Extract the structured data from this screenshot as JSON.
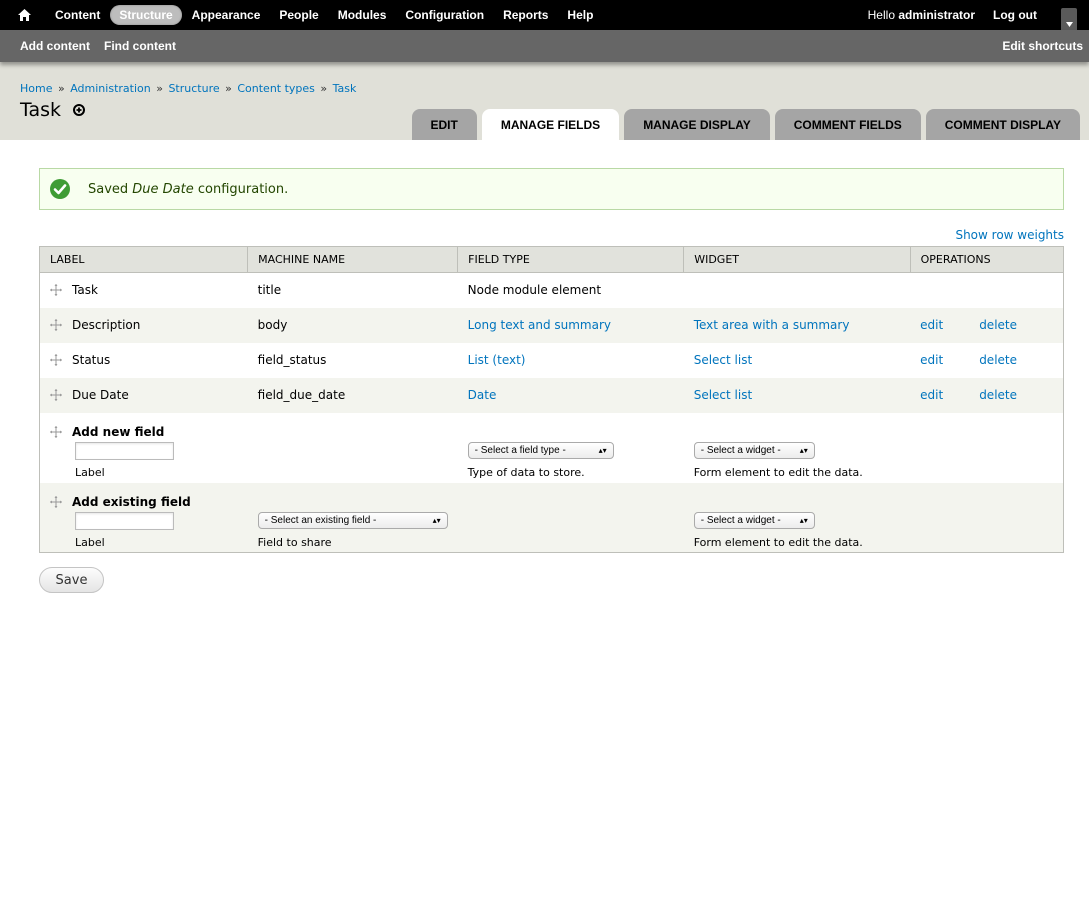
{
  "toolbar": {
    "menu": [
      "Content",
      "Structure",
      "Appearance",
      "People",
      "Modules",
      "Configuration",
      "Reports",
      "Help"
    ],
    "hello_prefix": "Hello ",
    "username": "administrator",
    "logout": "Log out"
  },
  "shortcuts": {
    "add_content": "Add content",
    "find_content": "Find content",
    "edit_shortcuts": "Edit shortcuts"
  },
  "breadcrumb": [
    "Home",
    "Administration",
    "Structure",
    "Content types",
    "Task"
  ],
  "breadcrumb_sep": "»",
  "page_title": "Task",
  "tabs": [
    "EDIT",
    "MANAGE FIELDS",
    "MANAGE DISPLAY",
    "COMMENT FIELDS",
    "COMMENT DISPLAY"
  ],
  "status": {
    "prefix": "Saved ",
    "field": "Due Date",
    "suffix": " configuration."
  },
  "show_row_weights": "Show row weights",
  "table": {
    "headers": [
      "LABEL",
      "MACHINE NAME",
      "FIELD TYPE",
      "WIDGET",
      "OPERATIONS"
    ],
    "rows": [
      {
        "label": "Task",
        "machine": "title",
        "type": "Node module element",
        "widget": "",
        "edit": "",
        "delete": ""
      },
      {
        "label": "Description",
        "machine": "body",
        "type": "Long text and summary",
        "widget": "Text area with a summary",
        "edit": "edit",
        "delete": "delete"
      },
      {
        "label": "Status",
        "machine": "field_status",
        "type": "List (text)",
        "widget": "Select list",
        "edit": "edit",
        "delete": "delete"
      },
      {
        "label": "Due Date",
        "machine": "field_due_date",
        "type": "Date",
        "widget": "Select list",
        "edit": "edit",
        "delete": "delete"
      }
    ]
  },
  "add_new": {
    "title": "Add new field",
    "label_desc": "Label",
    "type_select": "- Select a field type -",
    "type_desc": "Type of data to store.",
    "widget_select": "- Select a widget -",
    "widget_desc": "Form element to edit the data."
  },
  "add_existing": {
    "title": "Add existing field",
    "label_desc": "Label",
    "field_select": "- Select an existing field -",
    "field_desc": "Field to share",
    "widget_select": "- Select a widget -",
    "widget_desc": "Form element to edit the data."
  },
  "save": "Save",
  "colors": {
    "toolbar_bg": "#000000",
    "shortcuts_bg": "#666666",
    "header_bg": "#e0e0d8",
    "link": "#0074bd",
    "status_border": "#b9d9a5",
    "status_icon": "#3f9c35"
  },
  "icons": [
    "home-icon",
    "add-shortcut-icon",
    "check-icon",
    "drag-handle-icon",
    "drawer-toggle-icon"
  ]
}
